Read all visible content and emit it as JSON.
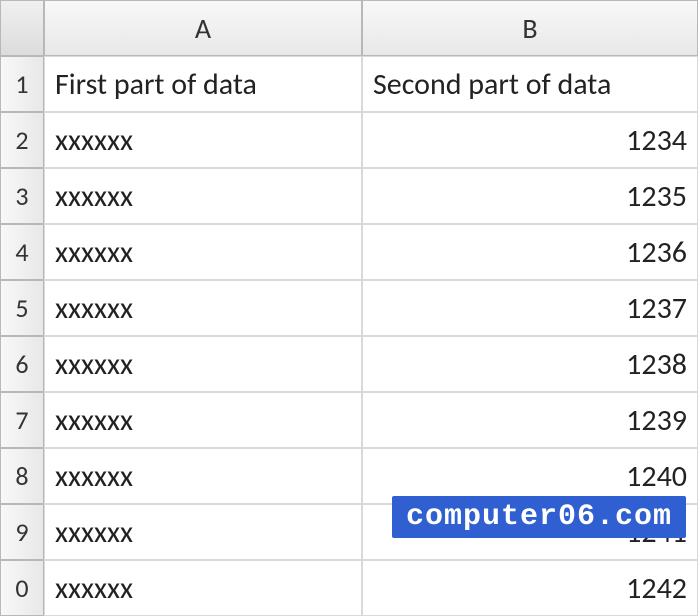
{
  "columns": [
    "A",
    "B"
  ],
  "row_numbers": [
    "1",
    "2",
    "3",
    "4",
    "5",
    "6",
    "7",
    "8",
    "9",
    "0"
  ],
  "headers": {
    "A": "First part of data",
    "B": "Second part of data"
  },
  "rows": [
    {
      "A": "xxxxxx",
      "B": "1234"
    },
    {
      "A": "xxxxxx",
      "B": "1235"
    },
    {
      "A": "xxxxxx",
      "B": "1236"
    },
    {
      "A": "xxxxxx",
      "B": "1237"
    },
    {
      "A": "xxxxxx",
      "B": "1238"
    },
    {
      "A": "xxxxxx",
      "B": "1239"
    },
    {
      "A": "xxxxxx",
      "B": "1240"
    },
    {
      "A": "xxxxxx",
      "B": "1241"
    },
    {
      "A": "xxxxxx",
      "B": "1242"
    }
  ],
  "watermark": "computer06.com"
}
